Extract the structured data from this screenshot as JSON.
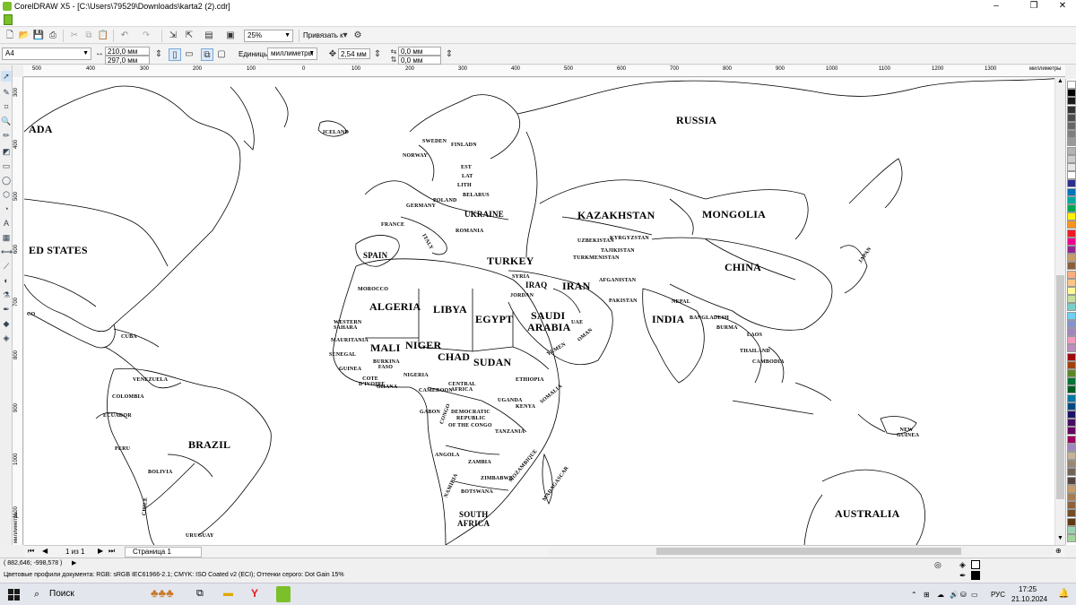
{
  "app": {
    "title": "CorelDRAW X5 - [C:\\Users\\79529\\Downloads\\karta2 (2).cdr]",
    "minimize": "–",
    "maximize": "❐",
    "close": "✕"
  },
  "toolbar": {
    "zoom": "25%",
    "snap_label": "Привязать к",
    "page_size": "A4",
    "width": "210,0 мм",
    "height": "297,0 мм",
    "units_label": "Единицы:",
    "units": "миллиметры",
    "nudge": "2,54 мм",
    "dup_x": "0,0 мм",
    "dup_y": "0,0 мм"
  },
  "ruler": {
    "h_ticks": [
      "500",
      "400",
      "300",
      "200",
      "100",
      "0",
      "100",
      "200",
      "300",
      "400",
      "500",
      "600",
      "700",
      "800",
      "900",
      "1000",
      "1100",
      "1200",
      "1300"
    ],
    "h_unit": "миллиметры",
    "v_ticks": [
      "300",
      "400",
      "500",
      "600",
      "700",
      "800",
      "900",
      "1000",
      "1100"
    ],
    "v_unit": "миллиметры"
  },
  "map_labels": {
    "russia": "RUSSIA",
    "canada": "ADA",
    "united_states": "ED STATES",
    "kazakhstan": "KAZAKHSTAN",
    "mongolia": "MONGOLIA",
    "china": "CHINA",
    "india": "INDIA",
    "iran": "IRAN",
    "iraq": "IRAQ",
    "turkey": "TURKEY",
    "ukraine": "UKRAINE",
    "poland": "POLAND",
    "germany": "GERMANY",
    "france": "FRANCE",
    "spain": "SPAIN",
    "italy": "ITALY",
    "romania": "ROMANIA",
    "belarus": "BELARUS",
    "finland": "FINLADN",
    "sweden": "SWEDEN",
    "norway": "NORWAY",
    "iceland": "ICELAND",
    "estonia": "EST",
    "latvia": "LAT",
    "lithuania": "LITH",
    "algeria": "ALGERIA",
    "libya": "LIBYA",
    "egypt": "EGYPT",
    "saudi": "SAUDI",
    "arabia": "ARABIA",
    "morocco": "MOROCCO",
    "western_sahara": "WESTERN SAHARA",
    "mauritania": "MAURITANIA",
    "mali": "MALI",
    "niger": "NIGER",
    "chad": "CHAD",
    "sudan": "SUDAN",
    "ethiopia": "ETHIOPIA",
    "somalia": "SOMALIA",
    "nigeria": "NIGERIA",
    "central_africa": "CENTRAL AFRICA",
    "drc1": "DEMOCRATIC",
    "drc2": "REPUBLIC",
    "drc3": "OF THE CONGO",
    "kenya": "KENYA",
    "tanzania": "TANZANIA",
    "angola": "ANGOLA",
    "zambia": "ZAMBIA",
    "namibia": "NAMIBIA",
    "botswana": "BOTSWANA",
    "south": "SOUTH",
    "africa": "AFRICA",
    "madagascar": "MADAGASCAR",
    "mozambique": "MOZAMBIQUE",
    "yemen": "YEMEN",
    "oman": "OMAN",
    "uae": "UAE",
    "syria": "SYRIA",
    "jordan": "JORDAN",
    "afganistan": "AFGANISTAN",
    "pakistan": "PAKISTAN",
    "uzbekistan": "UZBEKISTAN",
    "turkmenistan": "TURKMENISTAN",
    "kyrgyzstan": "KYRGYZSTAN",
    "tajikistan": "TAJIKISTAN",
    "nepal": "NEPAL",
    "bangladesh": "BANGLADESH",
    "burma": "BURMA",
    "laos": "LAOS",
    "thailand": "THAILAND",
    "cambodia": "CAMBODIA",
    "japan": "JAPAN",
    "australia": "AUSTRALIA",
    "new_guinea": "NEW GUINEA",
    "brazil": "BRAZIL",
    "bolivia": "BOLIVIA",
    "peru": "PERU",
    "chile": "CHILE",
    "ecuador": "ECUADOR",
    "colombia": "COLOMBIA",
    "venezuela": "VENEZUELA",
    "cuba": "CUBA",
    "mexico": "CO",
    "uruguay": "URUGUAY",
    "guinea": "GUINEA",
    "senegal": "SENEGAL",
    "cote": "COTE D'IVOIRE",
    "ghana": "GHANA",
    "burkina": "BURKINA FASO",
    "cameroon": "CAMEROON",
    "gabon": "GABON",
    "uganda": "UGANDA",
    "zimbabwe": "ZIMBABWE",
    "congo": "CONGO"
  },
  "pagebar": {
    "counter": "1 из 1",
    "page_tab": "Страница 1"
  },
  "status": {
    "coords": "( 882,646; -998,578 )",
    "color_profile": "Цветовые профили документа: RGB: sRGB IEC61966-2.1; CMYK: ISO Coated v2 (ECI); Оттенки серого: Dot Gain 15%"
  },
  "taskbar": {
    "search": "Поиск",
    "lang": "РУС",
    "time": "17:25",
    "date": "21.10.2024"
  },
  "palette_colors": [
    "#ffffff",
    "#000000",
    "#1a1a1a",
    "#333333",
    "#4d4d4d",
    "#666666",
    "#808080",
    "#999999",
    "#b3b3b3",
    "#cccccc",
    "#e6e6e6",
    "#ffffff",
    "#2b2f8f",
    "#0072bc",
    "#00a99d",
    "#00a651",
    "#fff200",
    "#f7941d",
    "#ed1c24",
    "#ec008c",
    "#92278f",
    "#c69c6d",
    "#8b5e3c",
    "#f9ad81",
    "#fdc689",
    "#fff799",
    "#c4df9b",
    "#7accc8",
    "#6dcff6",
    "#8493ca",
    "#a186be",
    "#f49ac1",
    "#bd8cbf",
    "#9e0b0f",
    "#a0410d",
    "#598527",
    "#007236",
    "#005e20",
    "#0076a3",
    "#004a80",
    "#1b1464",
    "#440e62",
    "#630460",
    "#9e005d",
    "#a186be",
    "#c7b299",
    "#998675",
    "#736357",
    "#534741",
    "#c69c6d",
    "#a67c52",
    "#8c6239",
    "#754c24",
    "#603913",
    "#9bd3ae",
    "#a3d39c"
  ]
}
